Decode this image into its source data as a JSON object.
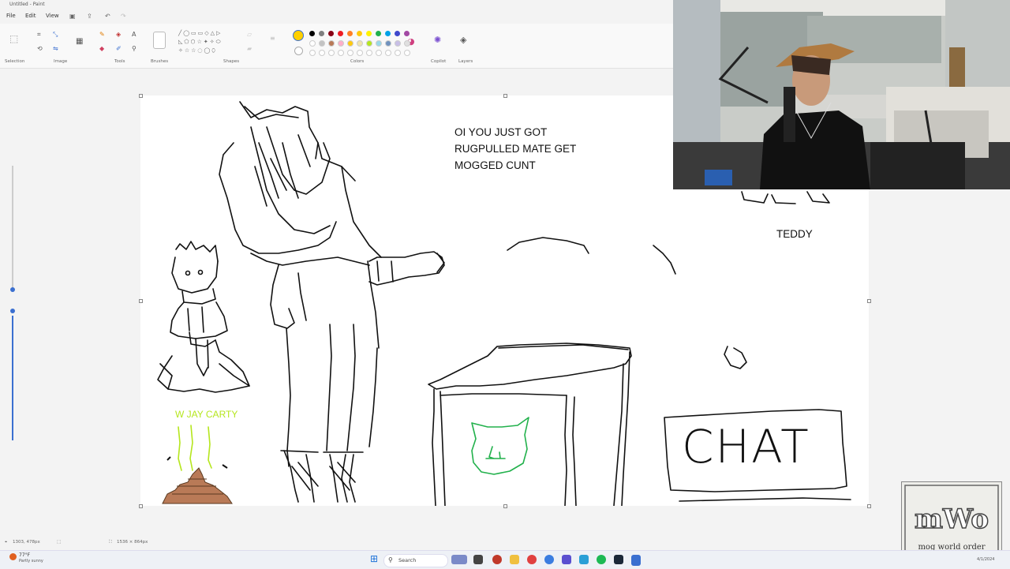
{
  "window": {
    "title": "Untitled - Paint"
  },
  "menu": {
    "file": "File",
    "edit": "Edit",
    "view": "View"
  },
  "ribbon": {
    "groups": {
      "selection": "Selection",
      "image": "Image",
      "tools": "Tools",
      "brushes": "Brushes",
      "shapes": "Shapes",
      "colors": "Colors",
      "copilot": "Copilot",
      "layers": "Layers"
    },
    "primary_color": "#ffd000",
    "swatches_row1": [
      "#000000",
      "#7f7f7f",
      "#880015",
      "#ed1c24",
      "#ff7f27",
      "#ffc90e",
      "#fff200",
      "#22b14c",
      "#00a2e8",
      "#3f48cc",
      "#a349a4"
    ],
    "swatches_row2": [
      "#ffffff",
      "#c3c3c3",
      "#b97a57",
      "#ffaec9",
      "#ffc90e",
      "#efe4b0",
      "#b5e61d",
      "#99d9ea",
      "#7092be",
      "#c8bfe7",
      "#e0e0e0"
    ]
  },
  "canvas": {
    "caption_line1": "OI YOU JUST GOT",
    "caption_line2": "RUGPULLED MATE GET",
    "caption_line3": "MOGGED CUNT",
    "teddy_label": "TEDDY",
    "jay_label": "W JAY CARTY",
    "chat_label": "CHAT"
  },
  "statusbar": {
    "position": "1303, 478px",
    "size": "1536 × 864px"
  },
  "taskbar": {
    "weather_temp": "77°F",
    "weather_desc": "Partly sunny",
    "search_placeholder": "Search",
    "time": "4/1/2024"
  },
  "logo": {
    "text": "mog world order"
  }
}
